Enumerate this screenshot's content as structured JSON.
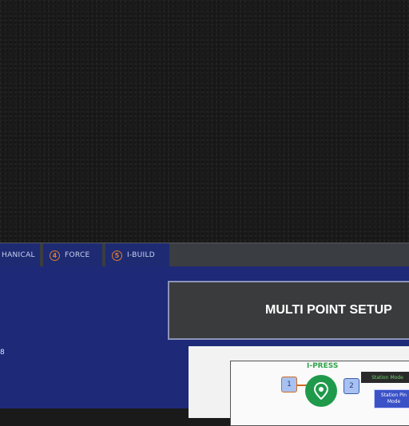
{
  "tabs": [
    {
      "label": "HANICAL",
      "number": ""
    },
    {
      "label": "FORCE",
      "number": "4"
    },
    {
      "label": "I-BUILD",
      "number": "5"
    }
  ],
  "main": {
    "left_edge_text": "8",
    "header_title": "MULTI POINT SETUP",
    "diagram": {
      "label": "I-PRESS",
      "node_1": "1",
      "node_2": "2",
      "tag_dark": "Station Mode",
      "tag_blue": "Station Pin Mode"
    }
  },
  "colors": {
    "main_bg": "#1e2a78",
    "tab_bg": "#1e2b72",
    "accent_orange": "#e07b2a",
    "pin_green": "#1f9a4a"
  }
}
